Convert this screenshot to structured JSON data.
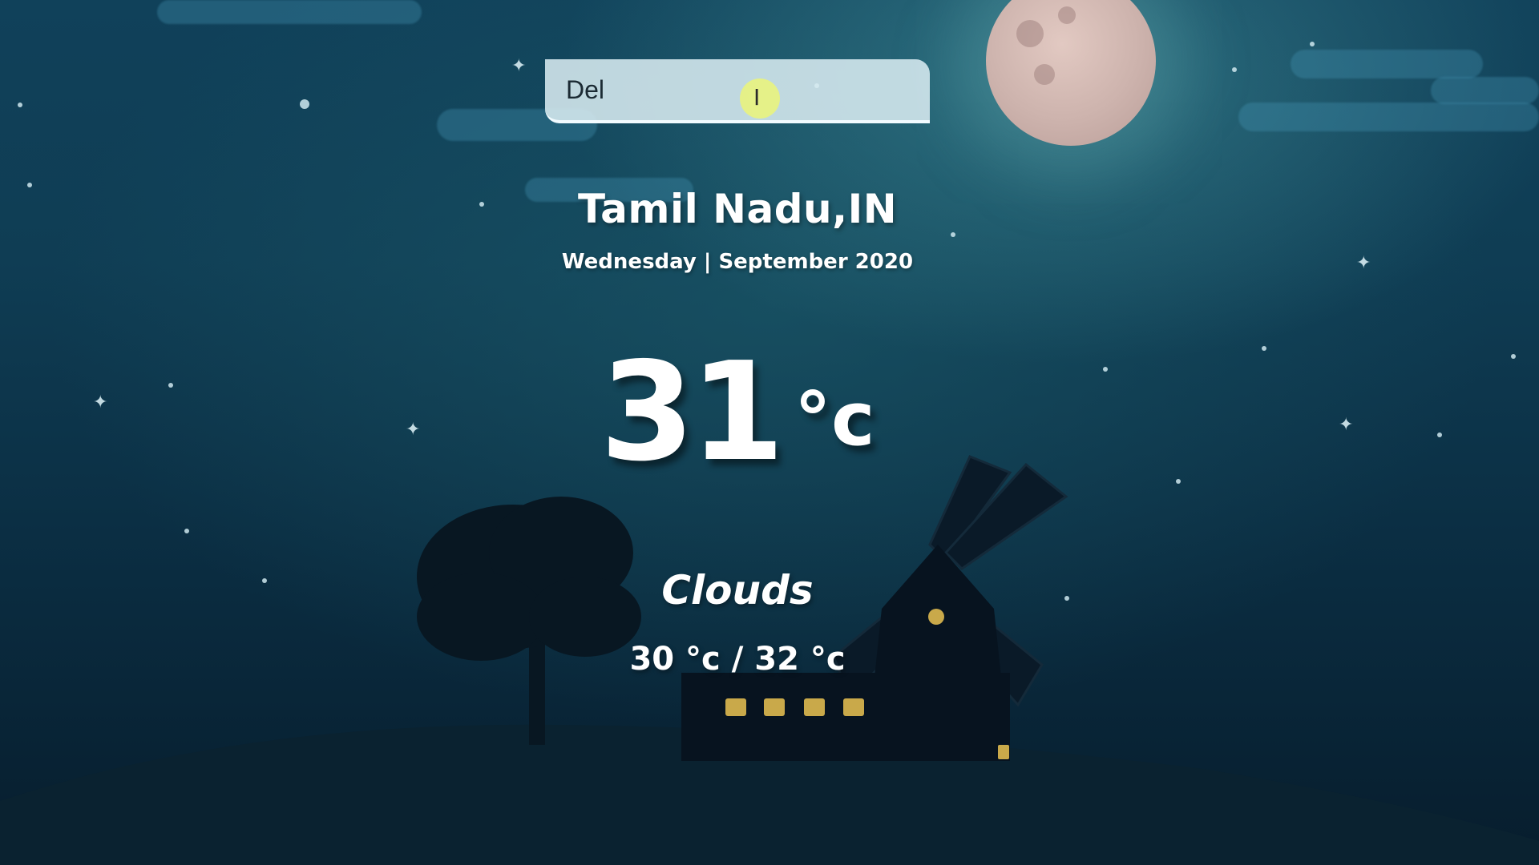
{
  "search": {
    "value": "Del"
  },
  "location": {
    "city": "Tamil Nadu,IN",
    "date": "Wednesday | September 2020"
  },
  "weather": {
    "temperature": "31",
    "unit": "°c",
    "condition": "Clouds",
    "hi_low": "30 °c / 32 °c"
  },
  "icons": {
    "moon": "moon-icon",
    "cursor": "text-cursor-icon"
  },
  "colors": {
    "sky_top": "#10415a",
    "sky_bottom": "#071d2d",
    "text": "#ffffff",
    "moon": "#cdb3ad",
    "window_light": "#c9a94a"
  }
}
